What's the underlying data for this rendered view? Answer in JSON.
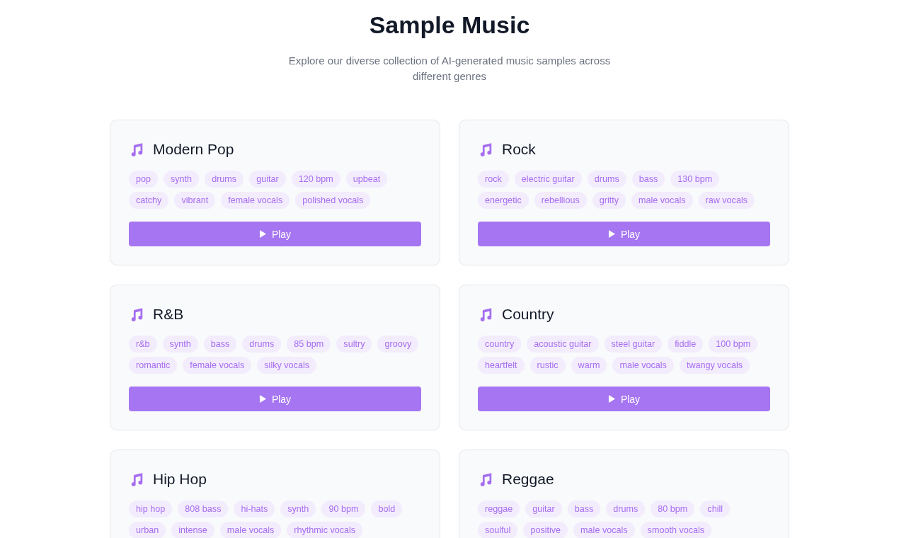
{
  "header": {
    "title": "Sample Music",
    "subtitle": "Explore our diverse collection of AI-generated music samples across different genres"
  },
  "samples": [
    {
      "title": "Modern Pop",
      "tags": [
        "pop",
        "synth",
        "drums",
        "guitar",
        "120 bpm",
        "upbeat",
        "catchy",
        "vibrant",
        "female vocals",
        "polished vocals"
      ],
      "button": "Play"
    },
    {
      "title": "Rock",
      "tags": [
        "rock",
        "electric guitar",
        "drums",
        "bass",
        "130 bpm",
        "energetic",
        "rebellious",
        "gritty",
        "male vocals",
        "raw vocals"
      ],
      "button": "Play"
    },
    {
      "title": "R&B",
      "tags": [
        "r&b",
        "synth",
        "bass",
        "drums",
        "85 bpm",
        "sultry",
        "groovy",
        "romantic",
        "female vocals",
        "silky vocals"
      ],
      "button": "Play"
    },
    {
      "title": "Country",
      "tags": [
        "country",
        "acoustic guitar",
        "steel guitar",
        "fiddle",
        "100 bpm",
        "heartfelt",
        "rustic",
        "warm",
        "male vocals",
        "twangy vocals"
      ],
      "button": "Play"
    },
    {
      "title": "Hip Hop",
      "tags": [
        "hip hop",
        "808 bass",
        "hi-hats",
        "synth",
        "90 bpm",
        "bold",
        "urban",
        "intense",
        "male vocals",
        "rhythmic vocals"
      ]
    },
    {
      "title": "Reggae",
      "tags": [
        "reggae",
        "guitar",
        "bass",
        "drums",
        "80 bpm",
        "chill",
        "soulful",
        "positive",
        "male vocals",
        "smooth vocals"
      ]
    }
  ]
}
